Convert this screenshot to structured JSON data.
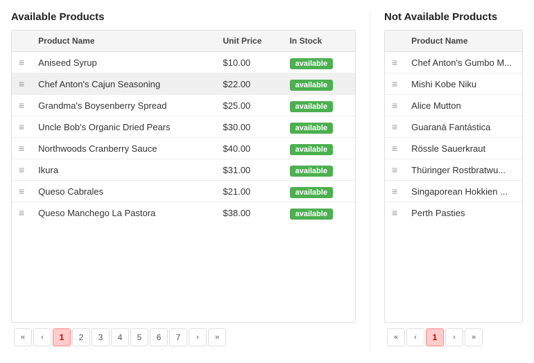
{
  "left_panel": {
    "title": "Available Products",
    "columns": [
      "",
      "Product Name",
      "Unit Price",
      "In Stock"
    ],
    "rows": [
      {
        "name": "Aniseed Syrup",
        "price": "$10.00",
        "stock": "available",
        "highlighted": false
      },
      {
        "name": "Chef Anton's Cajun Seasoning",
        "price": "$22.00",
        "stock": "available",
        "highlighted": true
      },
      {
        "name": "Grandma's Boysenberry Spread",
        "price": "$25.00",
        "stock": "available",
        "highlighted": false
      },
      {
        "name": "Uncle Bob's Organic Dried Pears",
        "price": "$30.00",
        "stock": "available",
        "highlighted": false
      },
      {
        "name": "Northwoods Cranberry Sauce",
        "price": "$40.00",
        "stock": "available",
        "highlighted": false
      },
      {
        "name": "Ikura",
        "price": "$31.00",
        "stock": "available",
        "highlighted": false
      },
      {
        "name": "Queso Cabrales",
        "price": "$21.00",
        "stock": "available",
        "highlighted": false
      },
      {
        "name": "Queso Manchego La Pastora",
        "price": "$38.00",
        "stock": "available",
        "highlighted": false
      }
    ],
    "pagination": {
      "current": 1,
      "pages": [
        1,
        2,
        3,
        4,
        5,
        6,
        7
      ],
      "first_label": "«",
      "prev_label": "‹",
      "next_label": "›",
      "last_label": "»"
    }
  },
  "right_panel": {
    "title": "Not Available Products",
    "columns": [
      "",
      "Product Name"
    ],
    "rows": [
      {
        "name": "Chef Anton's Gumbo M..."
      },
      {
        "name": "Mishi Kobe Niku"
      },
      {
        "name": "Alice Mutton"
      },
      {
        "name": "Guaraná Fantástica"
      },
      {
        "name": "Rössle Sauerkraut"
      },
      {
        "name": "Thüringer Rostbratwurs..."
      },
      {
        "name": "Singaporean Hokkien Fried Mee"
      },
      {
        "name": "Perth Pasties"
      }
    ],
    "pagination": {
      "current": 1,
      "first_label": "«",
      "prev_label": "‹",
      "next_label": "›",
      "last_label": "»"
    }
  },
  "drag_handle_symbol": "≡",
  "badge_label": "available"
}
